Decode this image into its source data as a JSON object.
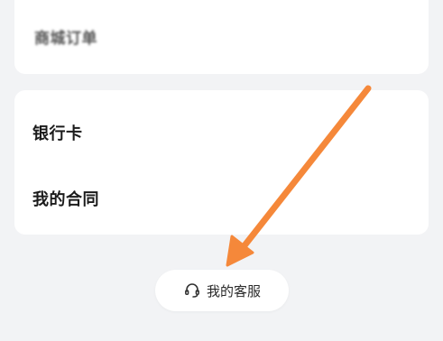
{
  "menu_top": {
    "mall_orders_label": "商城订单"
  },
  "menu_group": {
    "bank_card_label": "银行卡",
    "contract_label": "我的合同"
  },
  "service": {
    "label": "我的客服",
    "icon": "headset-icon"
  },
  "annotation": {
    "arrow_color": "#f5883a"
  },
  "colors": {
    "background": "#f2f3f5",
    "card": "#ffffff",
    "text": "#1a1a1a"
  }
}
